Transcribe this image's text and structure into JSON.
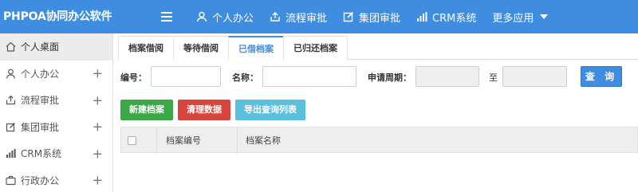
{
  "app": {
    "title": "PHPOA协同办公软件"
  },
  "topnav": {
    "items": [
      {
        "label": "个人办公",
        "icon": "user-icon"
      },
      {
        "label": "流程审批",
        "icon": "share-icon"
      },
      {
        "label": "集团审批",
        "icon": "edit-icon"
      },
      {
        "label": "CRM系统",
        "icon": "bar-chart-icon"
      },
      {
        "label": "更多应用",
        "icon": "chevron-down-icon"
      }
    ]
  },
  "sidebar": {
    "items": [
      {
        "label": "个人桌面",
        "icon": "home-icon",
        "expandable": false
      },
      {
        "label": "个人办公",
        "icon": "user-icon",
        "expandable": true
      },
      {
        "label": "流程审批",
        "icon": "share-icon",
        "expandable": true
      },
      {
        "label": "集团审批",
        "icon": "edit-icon",
        "expandable": true
      },
      {
        "label": "CRM系统",
        "icon": "bar-chart-icon",
        "expandable": true
      },
      {
        "label": "行政办公",
        "icon": "briefcase-icon",
        "expandable": true
      }
    ],
    "expand_symbol": "+"
  },
  "tabs": [
    {
      "label": "档案借阅"
    },
    {
      "label": "等待借阅"
    },
    {
      "label": "已借档案"
    },
    {
      "label": "已归还档案"
    }
  ],
  "search": {
    "number_label": "编号：",
    "name_label": "名称：",
    "period_label": "申请周期：",
    "to_label": "至",
    "search_button": "查 询",
    "number_value": "",
    "name_value": "",
    "start_value": "",
    "end_value": ""
  },
  "actions": {
    "new": "新建档案",
    "clear": "清理数据",
    "export": "导出查询列表"
  },
  "table": {
    "columns": [
      "档案编号",
      "档案名称"
    ]
  },
  "colors": {
    "primary": "#3f8de1",
    "green": "#39a845",
    "red": "#d9453c",
    "cyan": "#5bc0de"
  }
}
